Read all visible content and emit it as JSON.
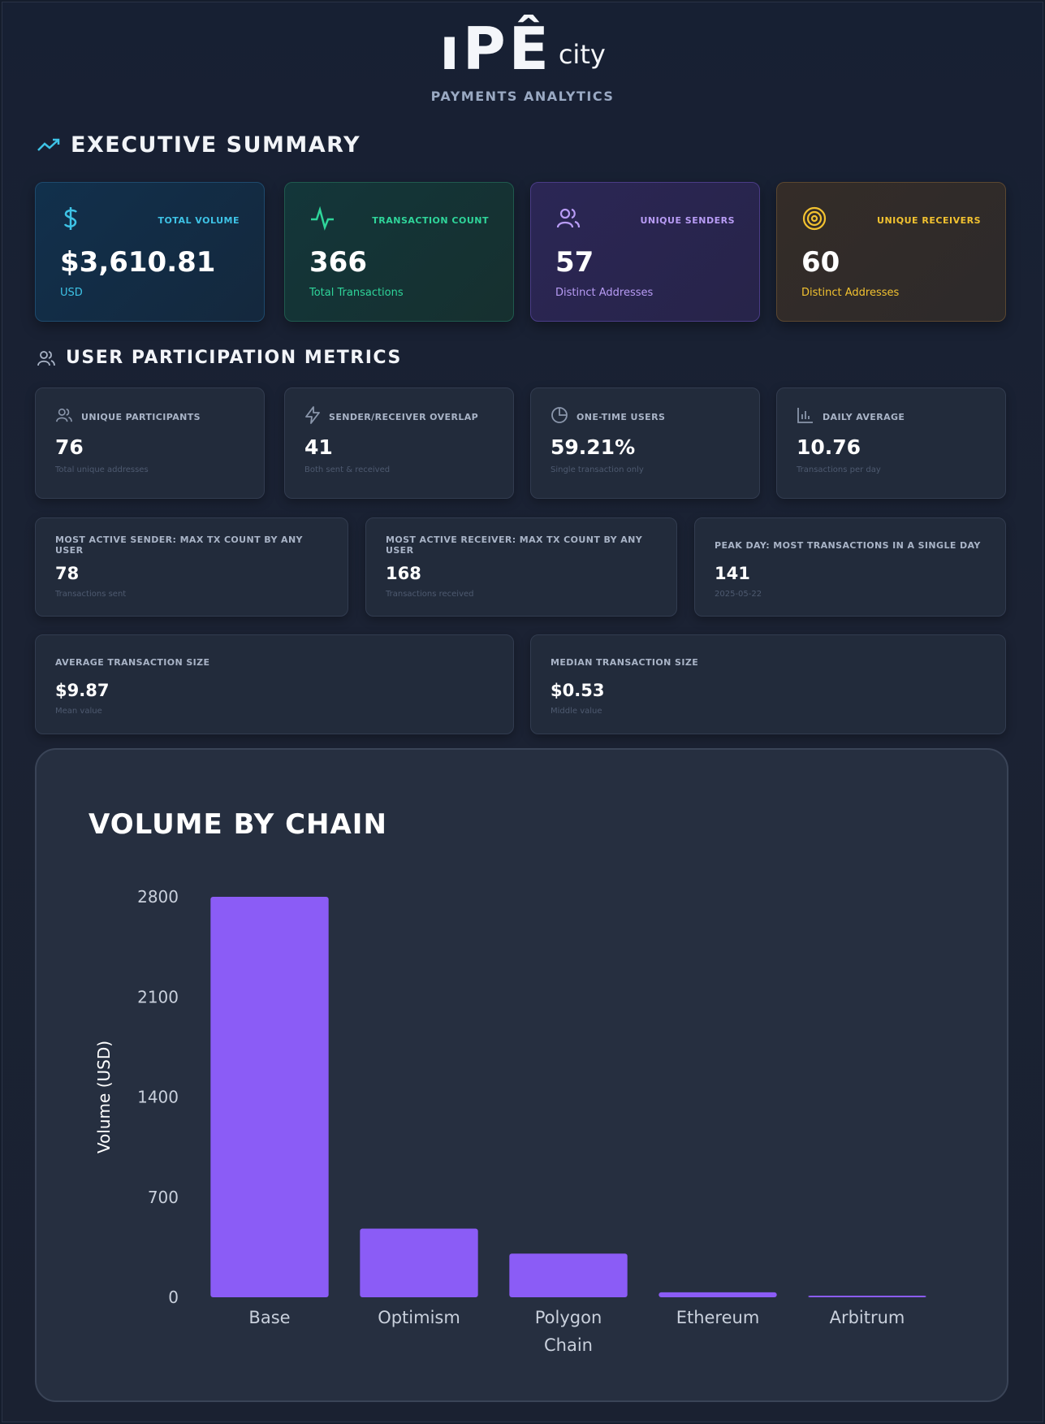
{
  "header": {
    "logo_main": "ıPÊ",
    "logo_sub": "city",
    "subtitle": "PAYMENTS ANALYTICS"
  },
  "executive_summary": {
    "title": "EXECUTIVE SUMMARY",
    "icon": "trending-up-icon",
    "cards": [
      {
        "label": "TOTAL VOLUME",
        "value": "$3,610.81",
        "sub": "USD",
        "icon": "dollar-icon",
        "color": "#3ec3e6"
      },
      {
        "label": "TRANSACTION COUNT",
        "value": "366",
        "sub": "Total Transactions",
        "icon": "activity-icon",
        "color": "#2fd59a"
      },
      {
        "label": "UNIQUE SENDERS",
        "value": "57",
        "sub": "Distinct Addresses",
        "icon": "users-icon",
        "color": "#b89cf5"
      },
      {
        "label": "UNIQUE RECEIVERS",
        "value": "60",
        "sub": "Distinct Addresses",
        "icon": "target-icon",
        "color": "#f2c230"
      }
    ]
  },
  "user_participation": {
    "title": "USER PARTICIPATION METRICS",
    "icon": "users-icon",
    "row1": [
      {
        "label": "UNIQUE PARTICIPANTS",
        "value": "76",
        "sub": "Total unique addresses",
        "icon": "users-icon"
      },
      {
        "label": "SENDER/RECEIVER OVERLAP",
        "value": "41",
        "sub": "Both sent & received",
        "icon": "zap-icon"
      },
      {
        "label": "ONE-TIME USERS",
        "value": "59.21%",
        "sub": "Single transaction only",
        "icon": "pie-chart-icon"
      },
      {
        "label": "DAILY AVERAGE",
        "value": "10.76",
        "sub": "Transactions per day",
        "icon": "bar-chart-icon"
      }
    ],
    "row2": [
      {
        "label": "MOST ACTIVE SENDER: MAX TX COUNT BY ANY USER",
        "value": "78",
        "sub": "Transactions sent"
      },
      {
        "label": "MOST ACTIVE RECEIVER: MAX TX COUNT BY ANY USER",
        "value": "168",
        "sub": "Transactions received"
      },
      {
        "label": "PEAK DAY: MOST TRANSACTIONS IN A SINGLE DAY",
        "value": "141",
        "sub": "2025-05-22"
      }
    ],
    "row3": [
      {
        "label": "AVERAGE TRANSACTION SIZE",
        "value": "$9.87",
        "sub": "Mean value"
      },
      {
        "label": "MEDIAN TRANSACTION SIZE",
        "value": "$0.53",
        "sub": "Middle value"
      }
    ]
  },
  "chart_data": {
    "type": "bar",
    "title": "VOLUME BY CHAIN",
    "xlabel": "",
    "ylabel": "Volume (USD)",
    "categories": [
      [
        "Base"
      ],
      [
        "Optimism"
      ],
      [
        "Polygon",
        "Chain"
      ],
      [
        "Ethereum"
      ],
      [
        "Arbitrum"
      ]
    ],
    "values": [
      2800,
      480,
      305,
      35,
      10
    ],
    "yticks": [
      0,
      700,
      1400,
      2100,
      2800
    ],
    "ylim": [
      0,
      2800
    ],
    "bar_color": "#8b5cf6",
    "grid": false,
    "legend": "none"
  }
}
